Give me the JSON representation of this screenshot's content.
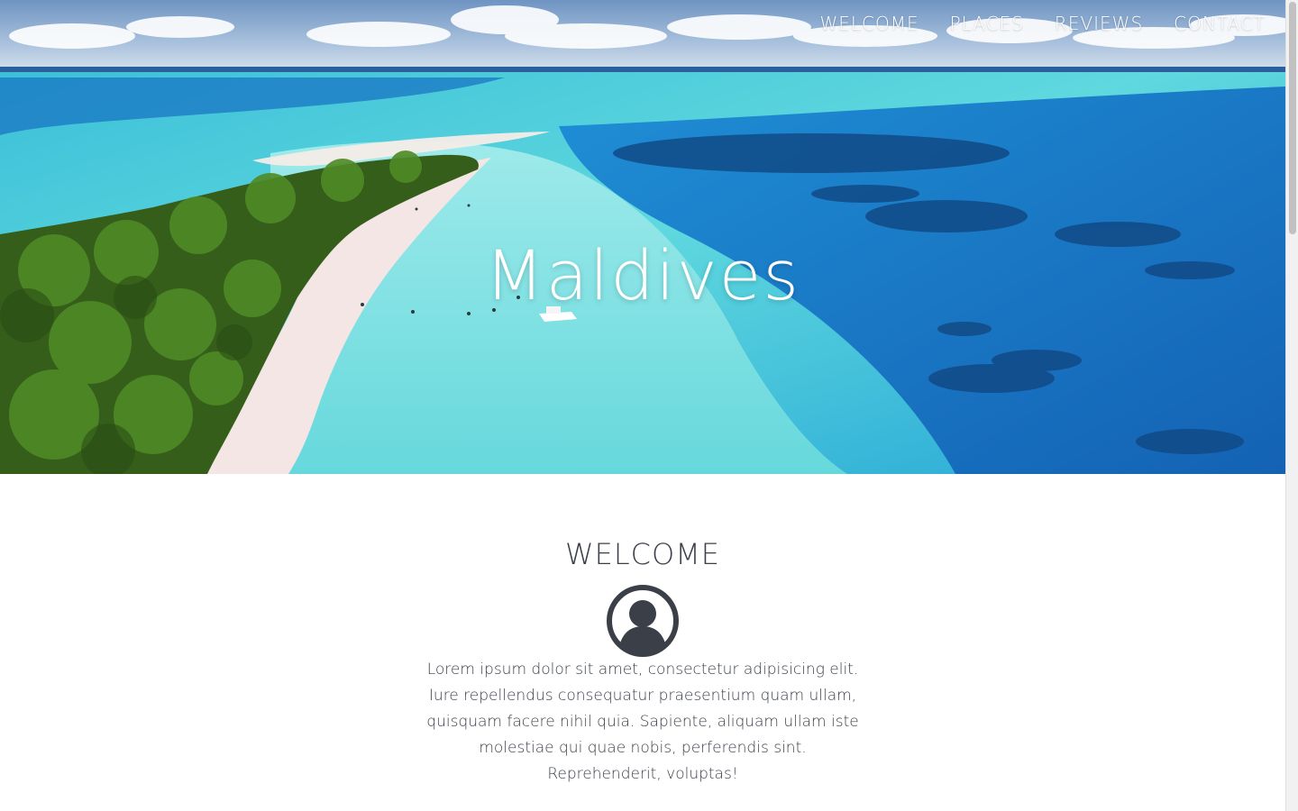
{
  "nav": {
    "items": [
      {
        "label": "WELCOME"
      },
      {
        "label": "PLACES"
      },
      {
        "label": "REVIEWS"
      },
      {
        "label": "CONTACT"
      }
    ]
  },
  "hero": {
    "title": "Maldives"
  },
  "welcome": {
    "heading": "WELCOME",
    "avatar_icon": "user-avatar-icon",
    "text": "Lorem ipsum dolor sit amet, consectetur adipisicing elit. Iure repellendus consequatur praesentium quam ullam, quisquam facere nihil quia. Sapiente, aliquam ullam iste molestiae qui quae nobis, perferendis sint. Reprehenderit, voluptas!"
  },
  "colors": {
    "text_dark": "#3a3f48",
    "nav_text": "#ffffff",
    "ocean_deep": "#1e79c8",
    "lagoon": "#4fd3d6",
    "sand": "#f1e4e2",
    "jungle": "#3d6b1f"
  }
}
